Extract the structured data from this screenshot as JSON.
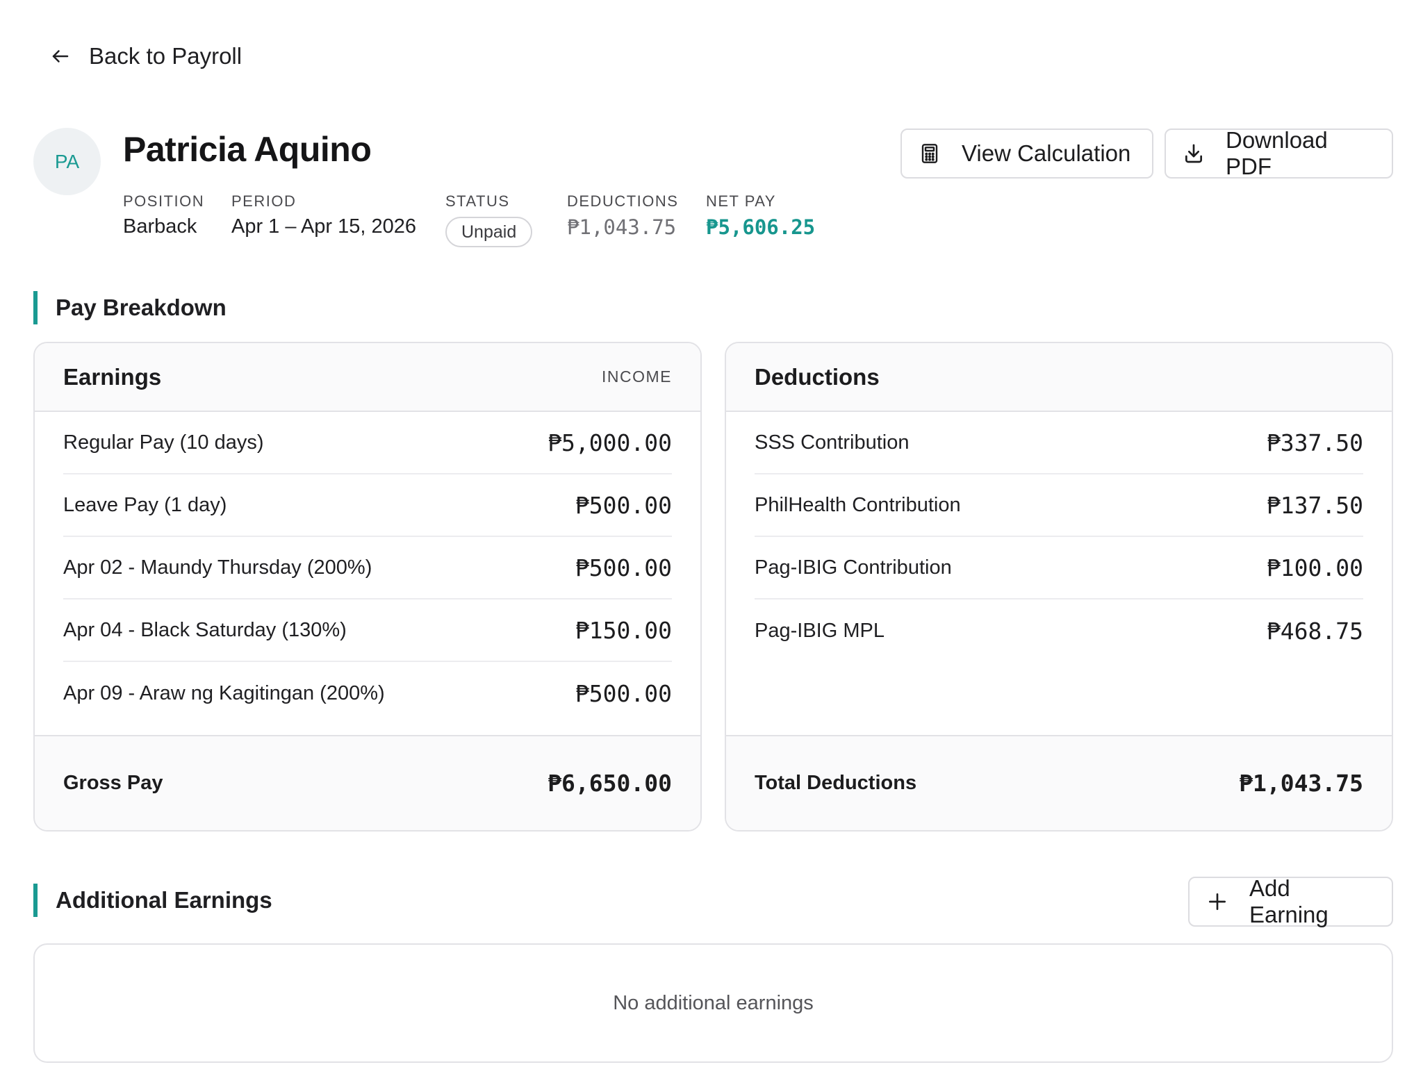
{
  "nav": {
    "back_label": "Back to Payroll"
  },
  "employee": {
    "initials": "PA",
    "name": "Patricia Aquino",
    "meta": {
      "position_label": "POSITION",
      "position": "Barback",
      "period_label": "PERIOD",
      "period": "Apr 1 – Apr 15, 2026",
      "status_label": "STATUS",
      "status": "Unpaid",
      "deductions_label": "DEDUCTIONS",
      "deductions": "₱1,043.75",
      "net_pay_label": "NET PAY",
      "net_pay": "₱5,606.25"
    }
  },
  "actions": {
    "view_calculation": "View Calculation",
    "download_pdf": "Download PDF"
  },
  "pay_breakdown": {
    "title": "Pay Breakdown",
    "earnings": {
      "title": "Earnings",
      "tag": "INCOME",
      "items": [
        {
          "label": "Regular Pay (10 days)",
          "amount": "₱5,000.00"
        },
        {
          "label": "Leave Pay (1 day)",
          "amount": "₱500.00"
        },
        {
          "label": "Apr 02 - Maundy Thursday (200%)",
          "amount": "₱500.00"
        },
        {
          "label": "Apr 04 - Black Saturday (130%)",
          "amount": "₱150.00"
        },
        {
          "label": "Apr 09 - Araw ng Kagitingan (200%)",
          "amount": "₱500.00"
        }
      ],
      "total_label": "Gross Pay",
      "total": "₱6,650.00"
    },
    "deductions": {
      "title": "Deductions",
      "items": [
        {
          "label": "SSS Contribution",
          "amount": "₱337.50"
        },
        {
          "label": "PhilHealth Contribution",
          "amount": "₱137.50"
        },
        {
          "label": "Pag-IBIG Contribution",
          "amount": "₱100.00"
        },
        {
          "label": "Pag-IBIG MPL",
          "amount": "₱468.75"
        }
      ],
      "total_label": "Total Deductions",
      "total": "₱1,043.75"
    }
  },
  "additional_earnings": {
    "title": "Additional Earnings",
    "add_label": "Add Earning",
    "empty_text": "No additional earnings"
  },
  "colors": {
    "accent": "#1a9a92",
    "border": "#e2e2e6",
    "muted_text": "#4a4a4e"
  },
  "icons": {
    "back": "arrow-left-icon",
    "calculation": "calculator-icon",
    "download": "download-icon",
    "add": "plus-icon"
  }
}
